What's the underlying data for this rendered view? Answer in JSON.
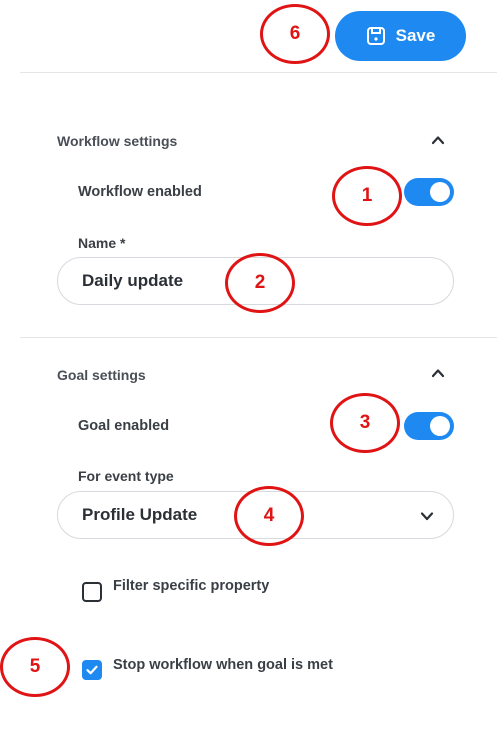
{
  "header": {
    "save_label": "Save"
  },
  "workflow_settings": {
    "title": "Workflow settings",
    "enabled_label": "Workflow enabled",
    "enabled": true,
    "name_label": "Name *",
    "name_value": "Daily update"
  },
  "goal_settings": {
    "title": "Goal settings",
    "enabled_label": "Goal enabled",
    "enabled": true,
    "event_type_label": "For event type",
    "event_type_value": "Profile Update",
    "filter_label": "Filter specific property",
    "filter_checked": false,
    "stop_label": "Stop workflow when goal is met",
    "stop_checked": true
  },
  "annotations": [
    "1",
    "2",
    "3",
    "4",
    "5",
    "6"
  ],
  "colors": {
    "accent": "#1e8af1",
    "annotation": "#e01414"
  },
  "icons": [
    "save-icon",
    "chevron-up-icon",
    "chevron-down-icon",
    "checkmark-icon"
  ]
}
